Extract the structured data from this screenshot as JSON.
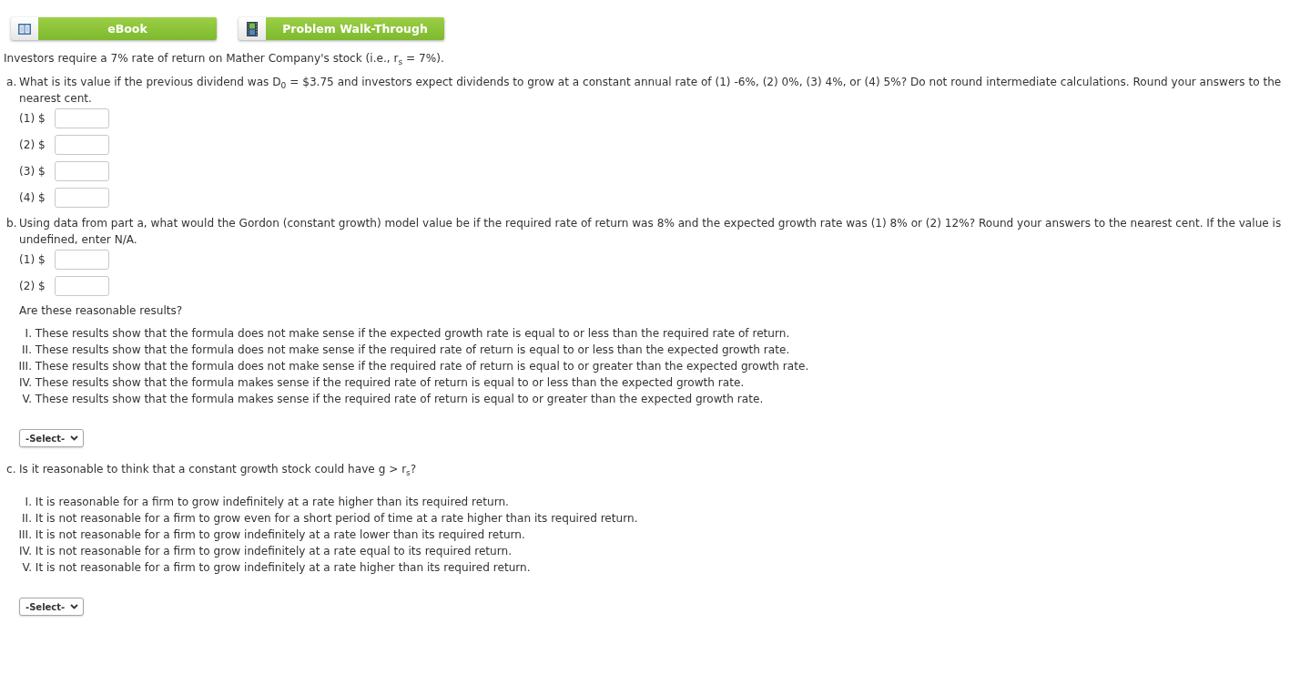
{
  "resource_buttons": [
    {
      "kind": "book",
      "label": "eBook"
    },
    {
      "kind": "film",
      "label": "Problem Walk-Through"
    }
  ],
  "intro": "Investors require a 7% rate of return on Mather Company's stock (i.e., r$_{s}$ = 7%).",
  "parts": [
    {
      "letter": "a.",
      "question": "What is its value if the previous dividend was D$_{0}$ = $3.75 and investors expect dividends to grow at a constant annual rate of (1) -6%, (2) 0%, (3) 4%, or (4) 5%? Do not round intermediate calculations. Round your answers to the nearest cent.",
      "answers": [
        {
          "label": "(1) $"
        },
        {
          "label": "(2) $"
        },
        {
          "label": "(3) $"
        },
        {
          "label": "(4) $"
        }
      ]
    },
    {
      "letter": "b.",
      "question": "Using data from part a, what would the Gordon (constant growth) model value be if the required rate of return was 8% and the expected growth rate was (1) 8% or (2) 12%? Round your answers to the nearest cent. If the value is undefined, enter N/A.",
      "answers": [
        {
          "label": "(1) $"
        },
        {
          "label": "(2) $"
        }
      ],
      "prompt": "Are these reasonable results?",
      "options": [
        {
          "numeral": "I.",
          "text": "These results show that the formula does not make sense if the expected growth rate is equal to or less than the required rate of return."
        },
        {
          "numeral": "II.",
          "text": "These results show that the formula does not make sense if the required rate of return is equal to or less than the expected growth rate."
        },
        {
          "numeral": "III.",
          "text": "These results show that the formula does not make sense if the required rate of return is equal to or greater than the expected growth rate."
        },
        {
          "numeral": "IV.",
          "text": "These results show that the formula makes sense if the required rate of return is equal to or less than the expected growth rate."
        },
        {
          "numeral": "V.",
          "text": "These results show that the formula makes sense if the required rate of return is equal to or greater than the expected growth rate."
        }
      ],
      "dropdown": {
        "value": "-Select-"
      }
    },
    {
      "letter": "c.",
      "question": "Is it reasonable to think that a constant growth stock could have g > r$_{s}$?",
      "options": [
        {
          "numeral": "I.",
          "text": "It is reasonable for a firm to grow indefinitely at a rate higher than its required return."
        },
        {
          "numeral": "II.",
          "text": "It is not reasonable for a firm to grow even for a short period of time at a rate higher than its required return."
        },
        {
          "numeral": "III.",
          "text": "It is not reasonable for a firm to grow indefinitely at a rate lower than its required return."
        },
        {
          "numeral": "IV.",
          "text": "It is not reasonable for a firm to grow indefinitely at a rate equal to its required return."
        },
        {
          "numeral": "V.",
          "text": "It is not reasonable for a firm to grow indefinitely at a rate higher than its required return."
        }
      ],
      "dropdown": {
        "value": "-Select-"
      }
    }
  ]
}
